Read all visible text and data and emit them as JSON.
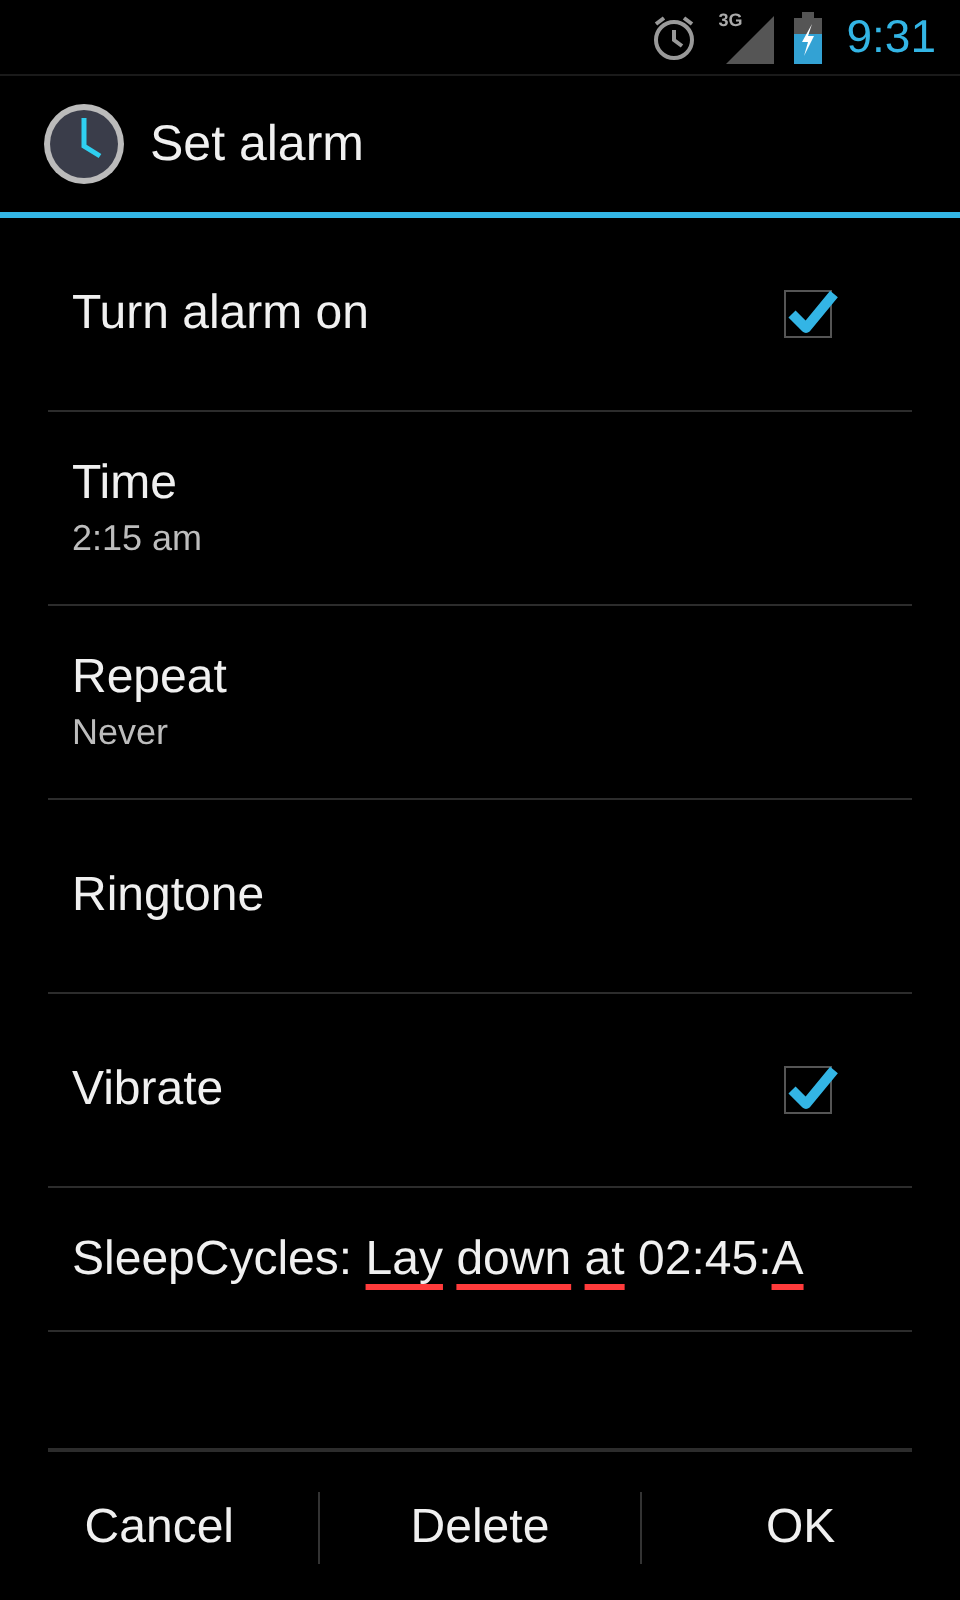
{
  "status_bar": {
    "network": "3G",
    "time": "9:31"
  },
  "dialog": {
    "title": "Set alarm",
    "items": [
      {
        "kind": "checkbox",
        "title": "Turn alarm on",
        "checked": true
      },
      {
        "kind": "summary",
        "title": "Time",
        "summary": "2:15 am"
      },
      {
        "kind": "summary",
        "title": "Repeat",
        "summary": "Never"
      },
      {
        "kind": "plain",
        "title": "Ringtone"
      },
      {
        "kind": "checkbox",
        "title": "Vibrate",
        "checked": true
      }
    ],
    "label_field": {
      "segments": [
        {
          "text": "SleepCycles:",
          "misspelled": false,
          "space_before": false
        },
        {
          "text": "Lay",
          "misspelled": true,
          "space_before": true
        },
        {
          "text": "down",
          "misspelled": true,
          "space_before": true
        },
        {
          "text": "at",
          "misspelled": true,
          "space_before": true
        },
        {
          "text": "02:45:",
          "misspelled": false,
          "space_before": true
        },
        {
          "text": "A",
          "misspelled": true,
          "space_before": false
        }
      ]
    },
    "buttons": [
      "Cancel",
      "Delete",
      "OK"
    ]
  }
}
